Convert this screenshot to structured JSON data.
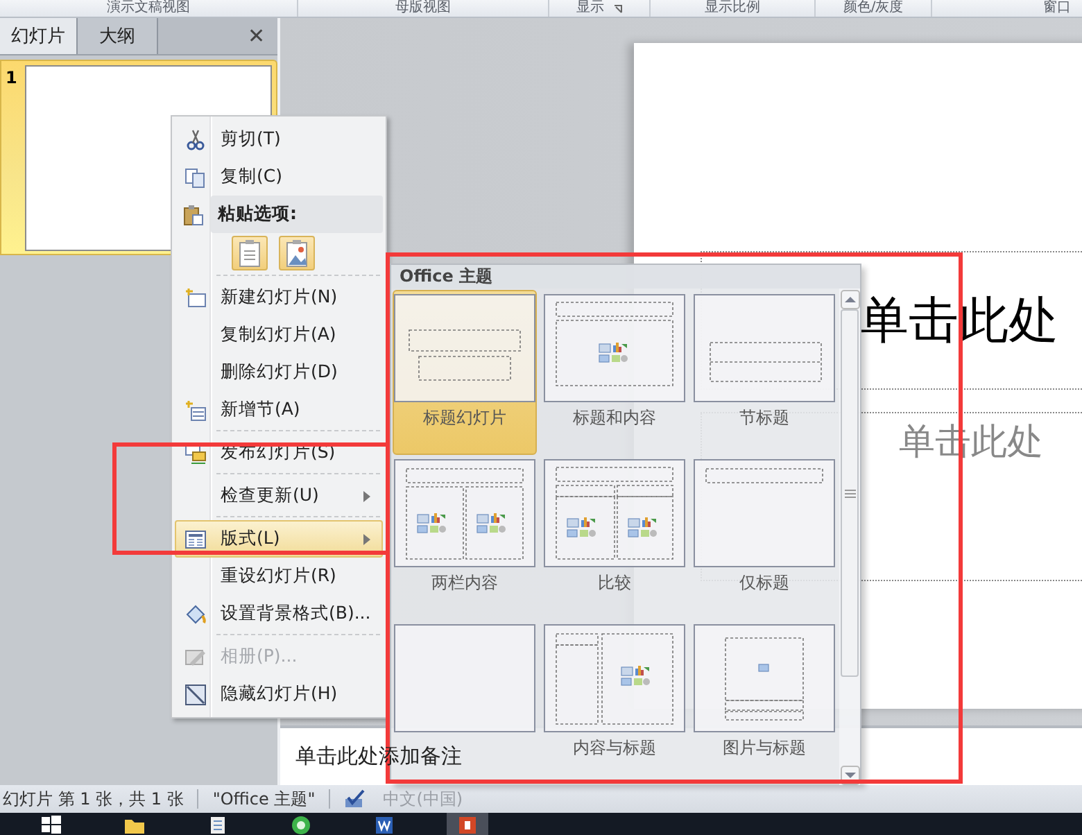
{
  "ribbon_groups": [
    {
      "label": "演示文稿视图"
    },
    {
      "label": "母版视图"
    },
    {
      "label": "显示",
      "launcher": true
    },
    {
      "label": "显示比例"
    },
    {
      "label": "颜色/灰度"
    },
    {
      "label": "窗口"
    }
  ],
  "left_pane": {
    "tabs": [
      {
        "label": "幻灯片",
        "selected": true
      },
      {
        "label": "大纲",
        "selected": false
      }
    ],
    "close": "✕",
    "slides": [
      {
        "number": "1",
        "selected": true
      }
    ]
  },
  "slide": {
    "title": "单击此处",
    "subtitle": "单击此处"
  },
  "notes": {
    "placeholder": "单击此处添加备注"
  },
  "context_menu": [
    {
      "kind": "item",
      "label": "剪切(T)",
      "disabled": false,
      "submenu": false,
      "selected": false
    },
    {
      "kind": "item",
      "label": "复制(C)",
      "disabled": false,
      "submenu": false,
      "selected": false
    },
    {
      "kind": "header",
      "label": "粘贴选项:"
    },
    {
      "kind": "paste-options"
    },
    {
      "kind": "separator"
    },
    {
      "kind": "item",
      "label": "新建幻灯片(N)",
      "disabled": false,
      "submenu": false,
      "selected": false
    },
    {
      "kind": "item",
      "label": "复制幻灯片(A)",
      "disabled": false,
      "submenu": false,
      "selected": false
    },
    {
      "kind": "item",
      "label": "删除幻灯片(D)",
      "disabled": false,
      "submenu": false,
      "selected": false
    },
    {
      "kind": "item",
      "label": "新增节(A)",
      "disabled": false,
      "submenu": false,
      "selected": false
    },
    {
      "kind": "separator"
    },
    {
      "kind": "item",
      "label": "发布幻灯片(S)",
      "disabled": false,
      "submenu": false,
      "selected": false
    },
    {
      "kind": "separator"
    },
    {
      "kind": "item",
      "label": "检查更新(U)",
      "disabled": false,
      "submenu": true,
      "selected": false
    },
    {
      "kind": "separator"
    },
    {
      "kind": "item",
      "label": "版式(L)",
      "disabled": false,
      "submenu": true,
      "selected": true
    },
    {
      "kind": "item",
      "label": "重设幻灯片(R)",
      "disabled": false,
      "submenu": false,
      "selected": false
    },
    {
      "kind": "item",
      "label": "设置背景格式(B)...",
      "disabled": false,
      "submenu": false,
      "selected": false
    },
    {
      "kind": "separator"
    },
    {
      "kind": "item",
      "label": "相册(P)...",
      "disabled": true,
      "submenu": false,
      "selected": false
    },
    {
      "kind": "item",
      "label": "隐藏幻灯片(H)",
      "disabled": false,
      "submenu": false,
      "selected": false
    }
  ],
  "layout_gallery": {
    "title": "Office 主题",
    "layouts": [
      {
        "kind": "title",
        "label": "标题幻灯片",
        "selected": true
      },
      {
        "kind": "title-content",
        "label": "标题和内容",
        "selected": false
      },
      {
        "kind": "section",
        "label": "节标题",
        "selected": false
      },
      {
        "kind": "two-content",
        "label": "两栏内容",
        "selected": false
      },
      {
        "kind": "comparison",
        "label": "比较",
        "selected": false
      },
      {
        "kind": "title-only",
        "label": "仅标题",
        "selected": false
      },
      {
        "kind": "blank",
        "selected": false
      },
      {
        "kind": "content-caption",
        "label": "内容与标题",
        "selected": false
      },
      {
        "kind": "picture-caption",
        "label": "图片与标题",
        "selected": false
      }
    ]
  },
  "status_bar": {
    "slide_info": "幻灯片 第 1 张，共 1 张",
    "theme": "\"Office 主题\"",
    "language": "中文(中国)"
  },
  "taskbar": [
    {
      "kind": "start",
      "selected": false
    },
    {
      "kind": "folder",
      "selected": false
    },
    {
      "kind": "notepad",
      "selected": false
    },
    {
      "kind": "browser",
      "selected": false
    },
    {
      "kind": "word",
      "selected": false
    },
    {
      "kind": "powerpoint",
      "selected": true
    }
  ]
}
